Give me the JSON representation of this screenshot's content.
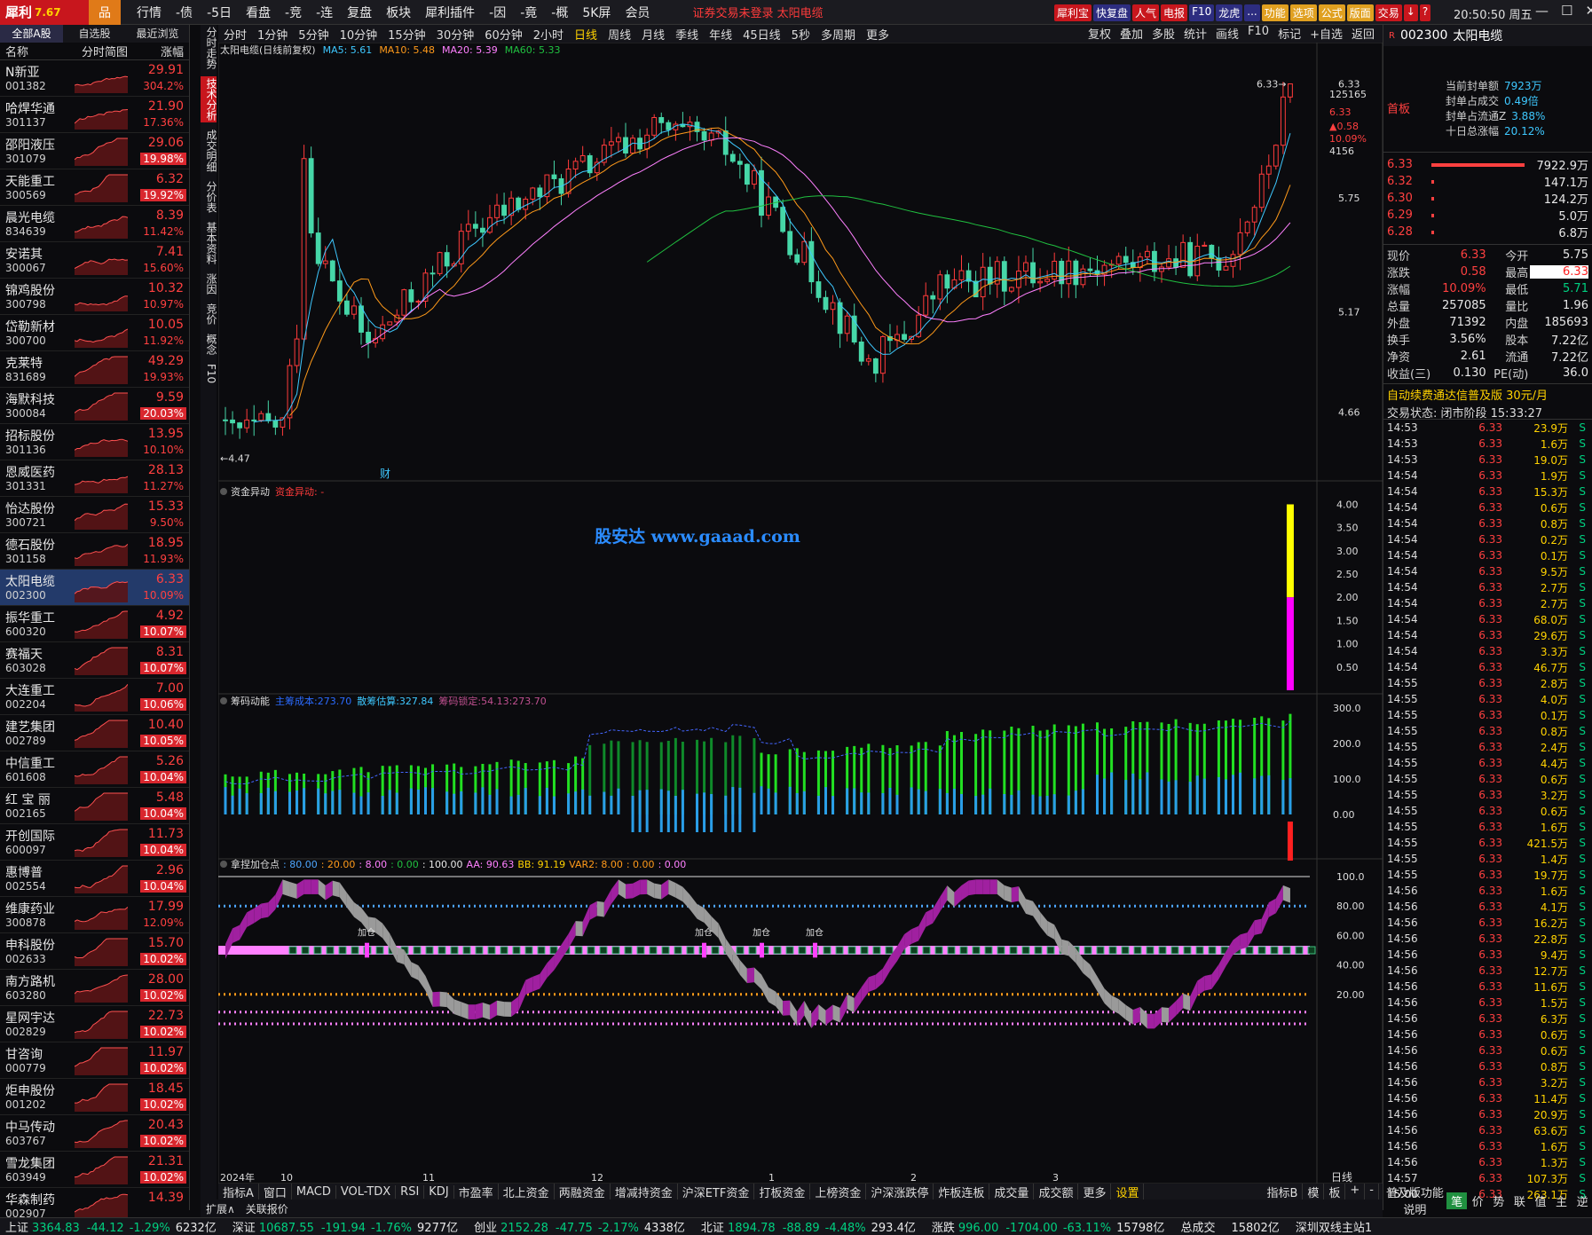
{
  "app": {
    "logo": "犀利",
    "version": "7.67",
    "home_icon": "home-icon"
  },
  "menu": [
    "行情",
    "-债",
    "-5日",
    "看盘",
    "-竞",
    "-连",
    "复盘",
    "板块",
    "犀利插件",
    "-因",
    "-竟",
    "-概",
    "5K屏",
    "会员"
  ],
  "notice": "证券交易未登录   太阳电缆",
  "toolbar": [
    {
      "label": "犀利宝",
      "bg": "#c8161d"
    },
    {
      "label": "快复盘",
      "bg": "#2d2d80"
    },
    {
      "label": "人气",
      "bg": "#c8161d"
    },
    {
      "label": "电报",
      "bg": "#c8161d"
    },
    {
      "label": "F10",
      "bg": "#2d2d80"
    },
    {
      "label": "龙虎",
      "bg": "#2d2d80"
    },
    {
      "label": "...",
      "bg": "#2d2d80"
    },
    {
      "label": "功能",
      "bg": "#e0a020"
    },
    {
      "label": "选项",
      "bg": "#e0a020"
    },
    {
      "label": "公式",
      "bg": "#e0a020"
    },
    {
      "label": "版面",
      "bg": "#e0a020"
    },
    {
      "label": "交易",
      "bg": "#c8161d"
    },
    {
      "label": "↓",
      "bg": "#c8161d"
    },
    {
      "label": "?",
      "bg": "#c8161d"
    }
  ],
  "clock": "20:50:50 周五",
  "left_tabs": [
    "全部A股",
    "自选股",
    "最近浏览"
  ],
  "left_header": {
    "name": "名称",
    "chart": "分时简图",
    "chg": "涨幅"
  },
  "stocks": [
    {
      "name": "N新亚",
      "code": "001382",
      "price": "29.91",
      "chg": "304.2%",
      "hl": false
    },
    {
      "name": "哈焊华通",
      "code": "301137",
      "price": "21.90",
      "chg": "17.36%",
      "hl": false
    },
    {
      "name": "邵阳液压",
      "code": "301079",
      "price": "29.06",
      "chg": "19.98%",
      "hl": true
    },
    {
      "name": "天能重工",
      "code": "300569",
      "price": "6.32",
      "chg": "19.92%",
      "hl": true
    },
    {
      "name": "晨光电缆",
      "code": "834639",
      "price": "8.39",
      "chg": "11.42%",
      "hl": false
    },
    {
      "name": "安诺其",
      "code": "300067",
      "price": "7.41",
      "chg": "15.60%",
      "hl": false
    },
    {
      "name": "锦鸡股份",
      "code": "300798",
      "price": "10.32",
      "chg": "10.97%",
      "hl": false
    },
    {
      "name": "岱勒新材",
      "code": "300700",
      "price": "10.05",
      "chg": "11.92%",
      "hl": false
    },
    {
      "name": "克莱特",
      "code": "831689",
      "price": "49.29",
      "chg": "19.93%",
      "hl": false
    },
    {
      "name": "海默科技",
      "code": "300084",
      "price": "9.59",
      "chg": "20.03%",
      "hl": true
    },
    {
      "name": "招标股份",
      "code": "301136",
      "price": "13.95",
      "chg": "10.10%",
      "hl": false
    },
    {
      "name": "恩威医药",
      "code": "301331",
      "price": "28.13",
      "chg": "11.27%",
      "hl": false
    },
    {
      "name": "怡达股份",
      "code": "300721",
      "price": "15.33",
      "chg": "9.50%",
      "hl": false
    },
    {
      "name": "德石股份",
      "code": "301158",
      "price": "18.95",
      "chg": "11.93%",
      "hl": false
    },
    {
      "name": "太阳电缆",
      "code": "002300",
      "price": "6.33",
      "chg": "10.09%",
      "hl": false,
      "sel": true
    },
    {
      "name": "振华重工",
      "code": "600320",
      "price": "4.92",
      "chg": "10.07%",
      "hl": true
    },
    {
      "name": "赛福天",
      "code": "603028",
      "price": "8.31",
      "chg": "10.07%",
      "hl": true
    },
    {
      "name": "大连重工",
      "code": "002204",
      "price": "7.00",
      "chg": "10.06%",
      "hl": true
    },
    {
      "name": "建艺集团",
      "code": "002789",
      "price": "10.40",
      "chg": "10.05%",
      "hl": true
    },
    {
      "name": "中信重工",
      "code": "601608",
      "price": "5.26",
      "chg": "10.04%",
      "hl": true
    },
    {
      "name": "红 宝 丽",
      "code": "002165",
      "price": "5.48",
      "chg": "10.04%",
      "hl": true
    },
    {
      "name": "开创国际",
      "code": "600097",
      "price": "11.73",
      "chg": "10.04%",
      "hl": true
    },
    {
      "name": "惠博普",
      "code": "002554",
      "price": "2.96",
      "chg": "10.04%",
      "hl": true
    },
    {
      "name": "维康药业",
      "code": "300878",
      "price": "17.99",
      "chg": "12.09%",
      "hl": false
    },
    {
      "name": "申科股份",
      "code": "002633",
      "price": "15.70",
      "chg": "10.02%",
      "hl": true
    },
    {
      "name": "南方路机",
      "code": "603280",
      "price": "28.00",
      "chg": "10.02%",
      "hl": true
    },
    {
      "name": "星网宇达",
      "code": "002829",
      "price": "22.73",
      "chg": "10.02%",
      "hl": true
    },
    {
      "name": "甘咨询",
      "code": "000779",
      "price": "11.97",
      "chg": "10.02%",
      "hl": true
    },
    {
      "name": "炬申股份",
      "code": "001202",
      "price": "18.45",
      "chg": "10.02%",
      "hl": true
    },
    {
      "name": "中马传动",
      "code": "603767",
      "price": "20.43",
      "chg": "10.02%",
      "hl": true
    },
    {
      "name": "雪龙集团",
      "code": "603949",
      "price": "21.31",
      "chg": "10.02%",
      "hl": true
    },
    {
      "name": "华森制药",
      "code": "002907",
      "price": "14.39",
      "chg": "",
      "hl": false
    }
  ],
  "vtabs": [
    "分时走势",
    "技术分析",
    "成交明细",
    "分价表",
    "基本资料",
    "涨因",
    "竞价",
    "概念",
    "F10"
  ],
  "periods": [
    "分时",
    "1分钟",
    "5分钟",
    "10分钟",
    "15分钟",
    "30分钟",
    "60分钟",
    "2小时",
    "日线",
    "周线",
    "月线",
    "季线",
    "年线",
    "45日线",
    "5秒",
    "多周期",
    "更多"
  ],
  "period_active": "日线",
  "righttools": [
    "复权",
    "叠加",
    "多股",
    "统计",
    "画线",
    "F10",
    "标记",
    "+自选",
    "返回"
  ],
  "main": {
    "title": "太阳电缆(日线前复权)",
    "ma": [
      {
        "t": "MA5: 5.61",
        "c": "#3ec8ff"
      },
      {
        "t": "MA10: 5.48",
        "c": "#ff9a1a"
      },
      {
        "t": "MA20: 5.39",
        "c": "#ff80ff"
      },
      {
        "t": "MA60: 5.33",
        "c": "#20c040"
      }
    ],
    "yticks": [
      "6.33",
      "5.75",
      "5.17",
      "4.66"
    ],
    "price_hi": "6.33",
    "price_lo": "4.47",
    "extra": [
      "125165",
      "6.33",
      "▲0.58",
      "10.09%",
      "4156"
    ],
    "cai": "财"
  },
  "chart_data": {
    "type": "candlestick",
    "xlabel": "",
    "ylabel": "",
    "x_labels": [
      "2024年",
      "10",
      "11",
      "12",
      "1",
      "2",
      "3"
    ],
    "ylim": [
      4.47,
      6.33
    ],
    "last_close": 6.33
  },
  "fund": {
    "title": "资金异动",
    "tag": "资金异动:  -",
    "yticks": [
      "4.00",
      "3.50",
      "3.00",
      "2.50",
      "2.00",
      "1.50",
      "1.00",
      "0.50"
    ],
    "watermark": "股安达 www.gaaad.com"
  },
  "chip": {
    "title": "筹码动能",
    "items": [
      {
        "t": "主筹成本:273.70",
        "c": "#2b6bff"
      },
      {
        "t": "散筹估算:327.84",
        "c": "#3ec8ff"
      },
      {
        "t": "筹码锁定:54.13:273.70",
        "c": "#c05090"
      }
    ],
    "yticks": [
      "300.0",
      "200.0",
      "100.0",
      "0.00"
    ]
  },
  "osc": {
    "title": "拿捏加仓点",
    "items": [
      {
        "t": ": 80.00",
        "c": "#4da6ff"
      },
      {
        "t": ": 20.00",
        "c": "#ff9a1a"
      },
      {
        "t": ": 8.00",
        "c": "#ff80ff"
      },
      {
        "t": ": 0.00",
        "c": "#20c040"
      },
      {
        "t": ": 100.00",
        "c": "#e8e8e8"
      },
      {
        "t": "AA: 90.63",
        "c": "#ff80ff"
      },
      {
        "t": "BB: 91.19",
        "c": "#ffd200"
      },
      {
        "t": "VAR2: 8.00",
        "c": "#ff9a1a"
      },
      {
        "t": ": 0.00",
        "c": "#ff9a1a"
      },
      {
        "t": ": 0.00",
        "c": "#ff80ff"
      }
    ],
    "yticks": [
      "100.0",
      "80.00",
      "60.00",
      "40.00",
      "20.00"
    ],
    "jiacang": "加仓"
  },
  "bottom_tabs": [
    "指标A",
    "窗口",
    "MACD",
    "VOL-TDX",
    "RSI",
    "KDJ",
    "市盈率",
    "北上资金",
    "两融资金",
    "增减持资金",
    "沪深ETF资金",
    "打板资金",
    "上榜资金",
    "沪深涨跌停",
    "炸板连板",
    "成交量",
    "成交额",
    "更多",
    "设置"
  ],
  "bottom_right": [
    "指标B",
    "模",
    "板",
    "+",
    "-"
  ],
  "expand": [
    "扩展∧",
    "关联报价"
  ],
  "xaxis_right": "日线",
  "rp": {
    "code": "002300",
    "name": "太阳电缆",
    "shouban": "首板",
    "seal": [
      {
        "l": "当前封单额",
        "v": "7923万"
      },
      {
        "l": "封单占成交",
        "v": "0.49倍"
      },
      {
        "l": "封单占流通Z",
        "v": "3.88%"
      },
      {
        "l": "十日总涨幅",
        "v": "20.12%"
      }
    ],
    "bids": [
      {
        "p": "6.33",
        "v": "7922.9万",
        "w": 0.95
      },
      {
        "p": "6.32",
        "v": "147.1万",
        "w": 0.02
      },
      {
        "p": "6.30",
        "v": "124.2万",
        "w": 0.02
      },
      {
        "p": "6.29",
        "v": "5.0万",
        "w": 0.01
      },
      {
        "p": "6.28",
        "v": "6.8万",
        "w": 0.01
      }
    ],
    "quote": [
      [
        "现价",
        "6.33",
        "今开",
        "5.75"
      ],
      [
        "涨跌",
        "0.58",
        "最高",
        "6.33"
      ],
      [
        "涨幅",
        "10.09%",
        "最低",
        "5.71"
      ],
      [
        "总量",
        "257085",
        "量比",
        "1.96"
      ],
      [
        "外盘",
        "71392",
        "内盘",
        "185693"
      ],
      [
        "换手",
        "3.56%",
        "股本",
        "7.22亿"
      ],
      [
        "净资",
        "2.61",
        "流通",
        "7.22亿"
      ],
      [
        "收益(三)",
        "0.130",
        "PE(动)",
        "36.0"
      ]
    ],
    "ad": "自动续费通达信普及版  30元/月",
    "trade_state": "交易状态: 闭市阶段 15:33:27",
    "ticks": [
      [
        "14:53",
        "6.33",
        "23.9万",
        "S"
      ],
      [
        "14:53",
        "6.33",
        "1.6万",
        "S"
      ],
      [
        "14:53",
        "6.33",
        "19.0万",
        "S"
      ],
      [
        "14:54",
        "6.33",
        "1.9万",
        "S"
      ],
      [
        "14:54",
        "6.33",
        "15.3万",
        "S"
      ],
      [
        "14:54",
        "6.33",
        "0.6万",
        "S"
      ],
      [
        "14:54",
        "6.33",
        "0.8万",
        "S"
      ],
      [
        "14:54",
        "6.33",
        "0.2万",
        "S"
      ],
      [
        "14:54",
        "6.33",
        "0.1万",
        "S"
      ],
      [
        "14:54",
        "6.33",
        "9.5万",
        "S"
      ],
      [
        "14:54",
        "6.33",
        "2.7万",
        "S"
      ],
      [
        "14:54",
        "6.33",
        "2.7万",
        "S"
      ],
      [
        "14:54",
        "6.33",
        "68.0万",
        "S"
      ],
      [
        "14:54",
        "6.33",
        "29.6万",
        "S"
      ],
      [
        "14:54",
        "6.33",
        "3.3万",
        "S"
      ],
      [
        "14:54",
        "6.33",
        "46.7万",
        "S"
      ],
      [
        "14:55",
        "6.33",
        "2.8万",
        "S"
      ],
      [
        "14:55",
        "6.33",
        "4.0万",
        "S"
      ],
      [
        "14:55",
        "6.33",
        "0.1万",
        "S"
      ],
      [
        "14:55",
        "6.33",
        "0.8万",
        "S"
      ],
      [
        "14:55",
        "6.33",
        "2.4万",
        "S"
      ],
      [
        "14:55",
        "6.33",
        "4.4万",
        "S"
      ],
      [
        "14:55",
        "6.33",
        "0.6万",
        "S"
      ],
      [
        "14:55",
        "6.33",
        "3.2万",
        "S"
      ],
      [
        "14:55",
        "6.33",
        "0.6万",
        "S"
      ],
      [
        "14:55",
        "6.33",
        "1.6万",
        "S"
      ],
      [
        "14:55",
        "6.33",
        "421.5万",
        "S"
      ],
      [
        "14:55",
        "6.33",
        "1.4万",
        "S"
      ],
      [
        "14:55",
        "6.33",
        "19.7万",
        "S"
      ],
      [
        "14:56",
        "6.33",
        "1.6万",
        "S"
      ],
      [
        "14:56",
        "6.33",
        "4.1万",
        "S"
      ],
      [
        "14:56",
        "6.33",
        "16.2万",
        "S"
      ],
      [
        "14:56",
        "6.33",
        "22.8万",
        "S"
      ],
      [
        "14:56",
        "6.33",
        "9.4万",
        "S"
      ],
      [
        "14:56",
        "6.33",
        "12.7万",
        "S"
      ],
      [
        "14:56",
        "6.33",
        "11.6万",
        "S"
      ],
      [
        "14:56",
        "6.33",
        "1.5万",
        "S"
      ],
      [
        "14:56",
        "6.33",
        "6.3万",
        "S"
      ],
      [
        "14:56",
        "6.33",
        "0.6万",
        "S"
      ],
      [
        "14:56",
        "6.33",
        "0.6万",
        "S"
      ],
      [
        "14:56",
        "6.33",
        "0.8万",
        "S"
      ],
      [
        "14:56",
        "6.33",
        "3.2万",
        "S"
      ],
      [
        "14:56",
        "6.33",
        "11.4万",
        "S"
      ],
      [
        "14:56",
        "6.33",
        "20.9万",
        "S"
      ],
      [
        "14:56",
        "6.33",
        "63.6万",
        "S"
      ],
      [
        "14:56",
        "6.33",
        "1.6万",
        "S"
      ],
      [
        "14:56",
        "6.33",
        "1.3万",
        "S"
      ],
      [
        "14:57",
        "6.33",
        "107.3万",
        "S"
      ],
      [
        "15:00",
        "6.33",
        "263.1万",
        "S"
      ]
    ],
    "bot": [
      "笔",
      "价",
      "势",
      "联",
      "值",
      "主",
      "逆"
    ],
    "bot_left": "普及版功能说明"
  },
  "status": [
    {
      "name": "上证",
      "v": "3364.83",
      "d": "-44.12",
      "p": "-1.29%",
      "a": "6232亿"
    },
    {
      "name": "深证",
      "v": "10687.55",
      "d": "-191.94",
      "p": "-1.76%",
      "a": "9277亿"
    },
    {
      "name": "创业",
      "v": "2152.28",
      "d": "-47.75",
      "p": "-2.17%",
      "a": "4338亿"
    },
    {
      "name": "北证",
      "v": "1894.78",
      "d": "-88.89",
      "p": "-4.48%",
      "a": "293.4亿"
    },
    {
      "name": "涨跌",
      "v": "996.00",
      "d": "-1704.00",
      "p": "-63.11%",
      "a": "15798亿"
    }
  ],
  "status_extra": [
    "总成交",
    "15802亿",
    "深圳双线主站1"
  ]
}
